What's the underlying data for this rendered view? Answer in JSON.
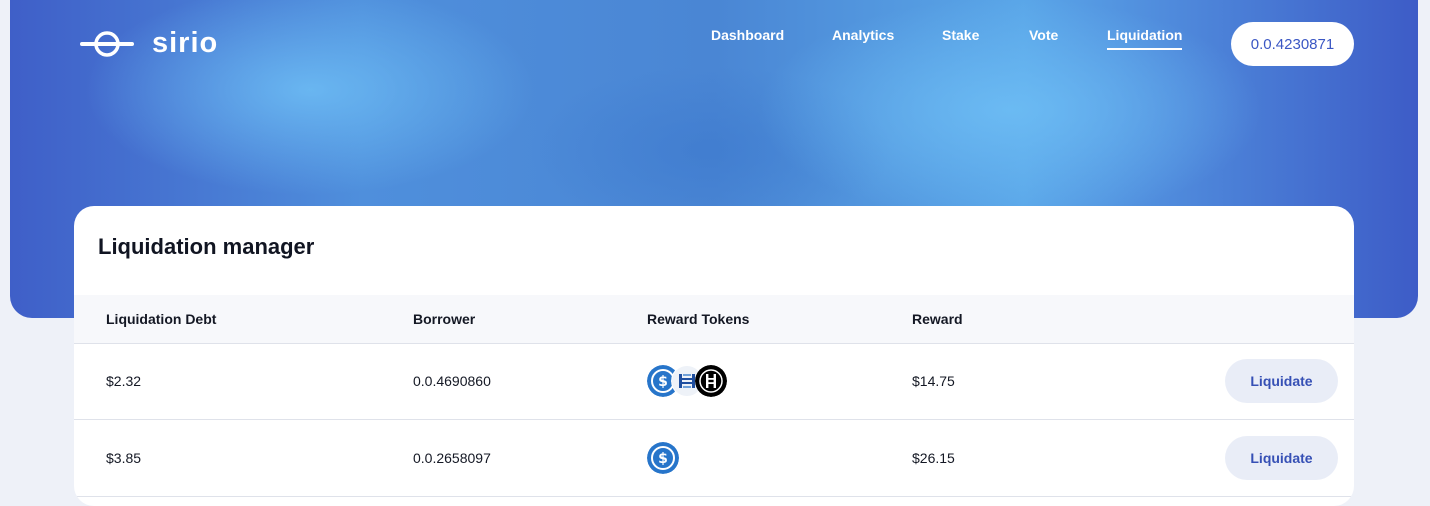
{
  "brand": {
    "name": "sirio"
  },
  "nav": {
    "items": [
      {
        "label": "Dashboard"
      },
      {
        "label": "Analytics"
      },
      {
        "label": "Stake"
      },
      {
        "label": "Vote"
      },
      {
        "label": "Liquidation",
        "active": true
      }
    ]
  },
  "account": {
    "id": "0.0.4230871"
  },
  "manager": {
    "title": "Liquidation manager",
    "columns": [
      "Liquidation Debt",
      "Borrower",
      "Reward Tokens",
      "Reward"
    ],
    "rows": [
      {
        "debt": "$2.32",
        "borrower": "0.0.4690860",
        "tokens": [
          "usdc-icon",
          "hbarx-icon",
          "hbar-icon"
        ],
        "reward": "$14.75",
        "action": "Liquidate"
      },
      {
        "debt": "$3.85",
        "borrower": "0.0.2658097",
        "tokens": [
          "usdc-icon"
        ],
        "reward": "$26.15",
        "action": "Liquidate"
      }
    ]
  },
  "colors": {
    "accent": "#3b57c4",
    "usdc": "#2775ca",
    "hbar": "#000000"
  }
}
